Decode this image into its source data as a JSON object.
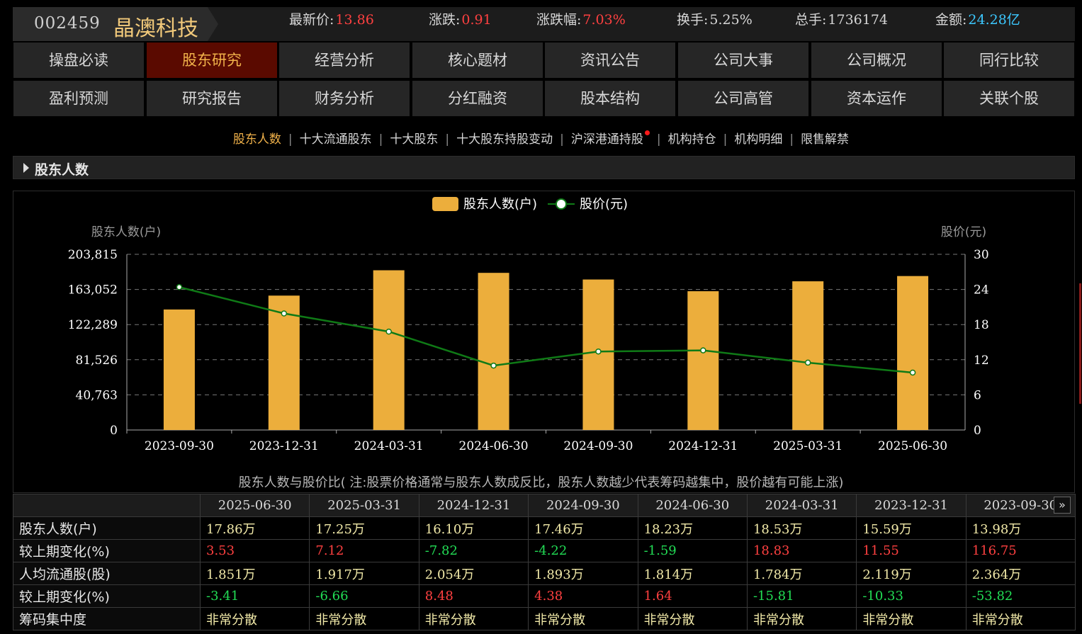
{
  "header": {
    "code": "002459",
    "name": "晶澳科技",
    "quotes": [
      {
        "label": "最新价:",
        "value": "13.86",
        "color": "red"
      },
      {
        "label": "涨跌:",
        "value": "0.91",
        "color": "red"
      },
      {
        "label": "涨跌幅:",
        "value": "7.03%",
        "color": "red"
      },
      {
        "label": "换手:",
        "value": "5.25%",
        "color": "plain"
      },
      {
        "label": "总手:",
        "value": "1736174",
        "color": "plain"
      },
      {
        "label": "金额:",
        "value": "24.28亿",
        "color": "cyan"
      }
    ]
  },
  "nav": {
    "row1": [
      "操盘必读",
      "股东研究",
      "经营分析",
      "核心题材",
      "资讯公告",
      "公司大事",
      "公司概况",
      "同行比较"
    ],
    "row2": [
      "盈利预测",
      "研究报告",
      "财务分析",
      "分红融资",
      "股本结构",
      "公司高管",
      "资本运作",
      "关联个股"
    ],
    "active": "股东研究"
  },
  "subnav": {
    "items": [
      "股东人数",
      "十大流通股东",
      "十大股东",
      "十大股东持股变动",
      "沪深港通持股",
      "机构持仓",
      "机构明细",
      "限售解禁"
    ],
    "active": "股东人数",
    "dot_item": "沪深港通持股"
  },
  "section": {
    "title": "股东人数"
  },
  "chart_data": {
    "type": "bar",
    "categories": [
      "2023-09-30",
      "2023-12-31",
      "2024-03-31",
      "2024-06-30",
      "2024-09-30",
      "2024-12-31",
      "2025-03-31",
      "2025-06-30"
    ],
    "series": [
      {
        "name": "股东人数(户)",
        "type": "bar",
        "axis": "left",
        "values": [
          139800,
          155900,
          185300,
          182300,
          174600,
          161000,
          172500,
          178600
        ]
      },
      {
        "name": "股价(元)",
        "type": "line",
        "axis": "right",
        "values": [
          24.4,
          19.9,
          16.8,
          11.0,
          13.4,
          13.6,
          11.5,
          9.8
        ]
      }
    ],
    "ylabel_left": "股东人数(户)",
    "ylabel_right": "股价(元)",
    "ylim_left": [
      0,
      203815
    ],
    "ylim_right": [
      0,
      30
    ],
    "yticks_left": [
      "0",
      "40,763",
      "81,526",
      "122,289",
      "163,052",
      "203,815"
    ],
    "yticks_right": [
      "0",
      "6",
      "12",
      "18",
      "24",
      "30"
    ],
    "grid": true,
    "legend": "top-center",
    "colors": {
      "bar": "#ecae3c",
      "line": "#0f7a16",
      "point_fill": "#ffffff"
    }
  },
  "chart_note": "股东人数与股价比( 注:股票价格通常与股东人数成反比，股东人数越少代表筹码越集中，股价越有可能上涨)",
  "table": {
    "dates": [
      "2025-06-30",
      "2025-03-31",
      "2024-12-31",
      "2024-09-30",
      "2024-06-30",
      "2024-03-31",
      "2023-12-31",
      "2023-09-30"
    ],
    "rows": [
      {
        "label": "股东人数(户)",
        "kind": "plain",
        "values": [
          "17.86万",
          "17.25万",
          "16.10万",
          "17.46万",
          "18.23万",
          "18.53万",
          "15.59万",
          "13.98万"
        ]
      },
      {
        "label": "较上期变化(%)",
        "kind": "signed",
        "values": [
          "3.53",
          "7.12",
          "-7.82",
          "-4.22",
          "-1.59",
          "18.83",
          "11.55",
          "116.75"
        ]
      },
      {
        "label": "人均流通股(股)",
        "kind": "plain",
        "values": [
          "1.851万",
          "1.917万",
          "2.054万",
          "1.893万",
          "1.814万",
          "1.784万",
          "2.119万",
          "2.364万"
        ]
      },
      {
        "label": "较上期变化(%)",
        "kind": "signed",
        "values": [
          "-3.41",
          "-6.66",
          "8.48",
          "4.38",
          "1.64",
          "-15.81",
          "-10.33",
          "-53.82"
        ]
      },
      {
        "label": "筹码集中度",
        "kind": "plain",
        "values": [
          "非常分散",
          "非常分散",
          "非常分散",
          "非常分散",
          "非常分散",
          "非常分散",
          "非常分散",
          "非常分散"
        ]
      }
    ],
    "scroll_icon": "double-chevron-right-icon",
    "scroll_glyph": "»"
  }
}
